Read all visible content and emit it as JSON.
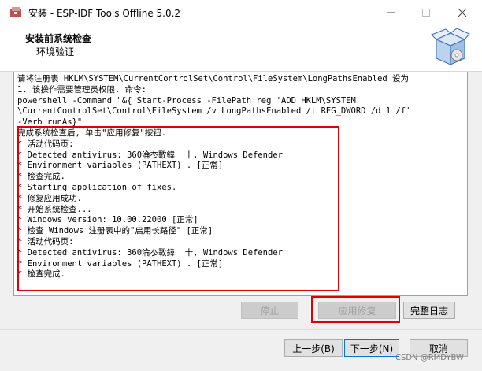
{
  "window": {
    "title": "安装 - ESP-IDF Tools Offline 5.0.2",
    "minimize_icon": "minimize-icon",
    "maximize_icon": "maximize-icon",
    "close_icon": "close-icon"
  },
  "header": {
    "title": "安装前系统检查",
    "subtitle": "环境验证"
  },
  "log": {
    "lines": [
      "请将注册表 HKLM\\SYSTEM\\CurrentControlSet\\Control\\FileSystem\\LongPathsEnabled 设为",
      "1. 该操作需要管理员权限. 命令:",
      "powershell -Command \"&{ Start-Process -FilePath reg 'ADD HKLM\\SYSTEM",
      "\\CurrentControlSet\\Control\\FileSystem /v LongPathsEnabled /t REG_DWORD /d 1 /f'",
      "-Verb runAs}\"",
      "完成系统检查后, 单击\"应用修复\"按钮.",
      "* 活动代码页:",
      "* Detected antivirus: 360淪冭斁鍏  十, Windows Defender",
      "* Environment variables (PATHEXT) . [正常]",
      "* 检查完成.",
      "* Starting application of fixes.",
      "* 修复应用成功.",
      "* 开始系统检查...",
      "* Windows version: 10.00.22000 [正常]",
      "* 检查 Windows 注册表中的\"启用长路径\" [正常]",
      "* 活动代码页:",
      "* Detected antivirus: 360淪冭斁鍏  十, Windows Defender",
      "* Environment variables (PATHEXT) . [正常]",
      "* 检查完成."
    ]
  },
  "actions": {
    "stop_label": "停止",
    "apply_fix_label": "应用修复",
    "full_log_label": "完整日志"
  },
  "nav": {
    "back_label": "上一步(B)",
    "next_label": "下一步(N)",
    "cancel_label": "取消"
  },
  "watermark": "CSDN @RMDYBW",
  "colors": {
    "highlight_red": "#e00000",
    "default_button_border": "#0078d7"
  }
}
